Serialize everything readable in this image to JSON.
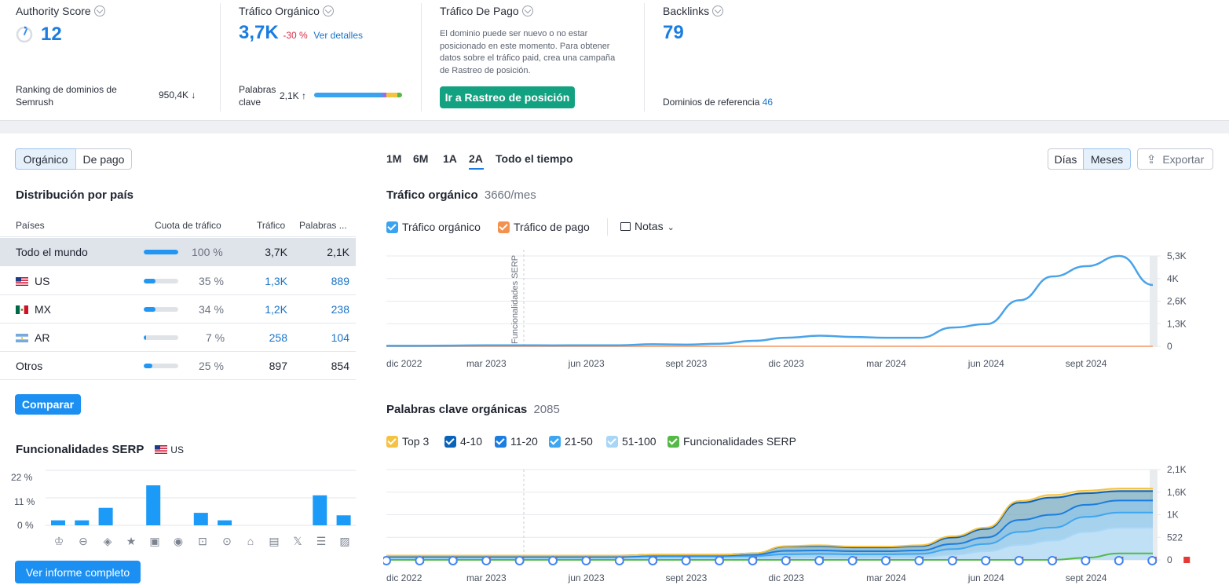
{
  "metrics": {
    "authority": {
      "title": "Authority Score",
      "value": "12",
      "rank_label": "Ranking de dominios de Semrush",
      "rank_value": "950,4K ↓"
    },
    "organic": {
      "title": "Tráfico Orgánico",
      "value": "3,7K",
      "change": "-30 %",
      "details": "Ver detalles",
      "kw_label": "Palabras clave",
      "kw_value": "2,1K ↑"
    },
    "paid": {
      "title": "Tráfico De Pago",
      "note": "El dominio puede ser nuevo o no estar posicionado en este momento. Para obtener datos sobre el tráfico paid, crea una campaña de Rastreo de posición.",
      "button": "Ir a Rastreo de posición"
    },
    "backlinks": {
      "title": "Backlinks",
      "value": "79",
      "ref_label": "Dominios de referencia",
      "ref_value": "46"
    }
  },
  "toggle": {
    "organic": "Orgánico",
    "paid": "De pago"
  },
  "country": {
    "title": "Distribución por país",
    "headers": [
      "Países",
      "Cuota de tráfico",
      "Tráfico",
      "Palabras ..."
    ],
    "rows": [
      {
        "name": "Todo el mundo",
        "share": "100 %",
        "share_pct": 100,
        "traffic": "3,7K",
        "keywords": "2,1K"
      },
      {
        "name": "US",
        "share": "35 %",
        "share_pct": 35,
        "traffic": "1,3K",
        "keywords": "889"
      },
      {
        "name": "MX",
        "share": "34 %",
        "share_pct": 34,
        "traffic": "1,2K",
        "keywords": "238"
      },
      {
        "name": "AR",
        "share": "7 %",
        "share_pct": 7,
        "traffic": "258",
        "keywords": "104"
      },
      {
        "name": "Otros",
        "share": "25 %",
        "share_pct": 25,
        "traffic": "897",
        "keywords": "854"
      }
    ],
    "compare": "Comparar"
  },
  "serp": {
    "title": "Funcionalidades SERP",
    "country": "US",
    "y_ticks": [
      "22 %",
      "11 %",
      "0 %"
    ],
    "values": [
      2,
      2,
      7,
      0,
      16,
      0,
      5,
      2,
      0,
      0,
      0,
      12,
      4
    ],
    "full_report": "Ver informe completo"
  },
  "periods": [
    "1M",
    "6M",
    "1A",
    "2A",
    "Todo el tiempo"
  ],
  "view": {
    "days": "Días",
    "months": "Meses",
    "export": "Exportar"
  },
  "traffic_chart": {
    "title": "Tráfico orgánico",
    "value": "3660/mes",
    "legend": [
      "Tráfico orgánico",
      "Tráfico de pago"
    ],
    "notes": "Notas",
    "annotation": "Funcionalidades SERP",
    "y_ticks": [
      "5,3K",
      "4K",
      "2,6K",
      "1,3K",
      "0"
    ],
    "x_ticks": [
      "dic 2022",
      "mar 2023",
      "jun 2023",
      "sept 2023",
      "dic 2023",
      "mar 2024",
      "jun 2024",
      "sept 2024"
    ]
  },
  "keywords_chart": {
    "title": "Palabras clave orgánicas",
    "value": "2085",
    "legend": [
      "Top 3",
      "4-10",
      "11-20",
      "21-50",
      "51-100",
      "Funcionalidades SERP"
    ],
    "legend_colors": [
      "#f5c242",
      "#0a63b8",
      "#1b7de0",
      "#3ea6f0",
      "#a8d6f7",
      "#56b847"
    ],
    "y_ticks": [
      "2,1K",
      "1,6K",
      "1K",
      "522",
      "0"
    ],
    "x_ticks": [
      "dic 2022",
      "mar 2023",
      "jun 2023",
      "sept 2023",
      "dic 2023",
      "mar 2024",
      "jun 2024",
      "sept 2024"
    ]
  },
  "chart_data": [
    {
      "type": "line",
      "title": "Tráfico orgánico",
      "x": [
        "dic 2022",
        "ene 2023",
        "feb 2023",
        "mar 2023",
        "abr 2023",
        "may 2023",
        "jun 2023",
        "jul 2023",
        "ago 2023",
        "sept 2023",
        "oct 2023",
        "nov 2023",
        "dic 2023",
        "ene 2024",
        "feb 2024",
        "mar 2024",
        "abr 2024",
        "may 2024",
        "jun 2024",
        "jul 2024",
        "ago 2024",
        "sept 2024",
        "oct 2024",
        "nov 2024"
      ],
      "series": [
        {
          "name": "Tráfico orgánico",
          "values": [
            30,
            30,
            40,
            60,
            60,
            50,
            60,
            60,
            120,
            100,
            150,
            320,
            500,
            620,
            550,
            500,
            500,
            1100,
            1300,
            2700,
            4100,
            4700,
            5300,
            3600
          ]
        },
        {
          "name": "Tráfico de pago",
          "values": [
            0,
            0,
            0,
            0,
            0,
            0,
            0,
            0,
            0,
            0,
            0,
            0,
            0,
            0,
            0,
            0,
            0,
            0,
            0,
            0,
            0,
            0,
            0,
            0
          ]
        }
      ],
      "ylim": [
        0,
        5300
      ]
    },
    {
      "type": "area",
      "title": "Palabras clave orgánicas",
      "x": [
        "dic 2022",
        "ene 2023",
        "feb 2023",
        "mar 2023",
        "abr 2023",
        "may 2023",
        "jun 2023",
        "jul 2023",
        "ago 2023",
        "sept 2023",
        "oct 2023",
        "nov 2023",
        "dic 2023",
        "ene 2024",
        "feb 2024",
        "mar 2024",
        "abr 2024",
        "may 2024",
        "jun 2024",
        "jul 2024",
        "ago 2024",
        "sept 2024",
        "oct 2024",
        "nov 2024"
      ],
      "series": [
        {
          "name": "Top 3",
          "values": [
            0,
            0,
            0,
            0,
            0,
            0,
            0,
            0,
            0,
            0,
            0,
            0,
            10,
            20,
            20,
            20,
            20,
            30,
            30,
            40,
            60,
            60,
            60,
            60
          ]
        },
        {
          "name": "4-10",
          "values": [
            20,
            20,
            20,
            20,
            20,
            20,
            20,
            20,
            20,
            20,
            20,
            30,
            100,
            100,
            90,
            90,
            100,
            150,
            200,
            400,
            400,
            270,
            220,
            220
          ]
        },
        {
          "name": "11-20",
          "values": [
            20,
            20,
            20,
            20,
            20,
            20,
            20,
            20,
            20,
            20,
            20,
            30,
            80,
            80,
            70,
            70,
            80,
            120,
            150,
            280,
            300,
            280,
            280,
            280
          ]
        },
        {
          "name": "21-50",
          "values": [
            30,
            30,
            30,
            30,
            30,
            30,
            30,
            30,
            40,
            40,
            40,
            50,
            80,
            80,
            80,
            70,
            80,
            130,
            170,
            300,
            300,
            350,
            350,
            350
          ]
        },
        {
          "name": "51-100",
          "values": [
            30,
            30,
            30,
            30,
            30,
            30,
            30,
            30,
            40,
            40,
            40,
            40,
            50,
            60,
            50,
            60,
            60,
            120,
            200,
            350,
            450,
            650,
            750,
            750
          ]
        },
        {
          "name": "Funcionalidades SERP",
          "values": [
            0,
            0,
            0,
            0,
            0,
            0,
            0,
            0,
            0,
            0,
            0,
            0,
            0,
            0,
            0,
            0,
            0,
            0,
            0,
            0,
            0,
            50,
            150,
            150
          ]
        }
      ],
      "ylim": [
        0,
        2100
      ]
    }
  ]
}
